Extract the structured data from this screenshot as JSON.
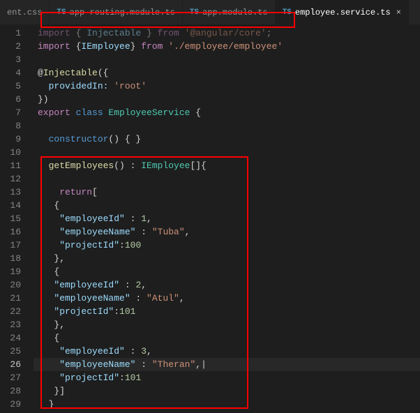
{
  "tabs": [
    {
      "icon": "",
      "label": "ent.css"
    },
    {
      "icon": "TS",
      "label": "app-routing.module.ts"
    },
    {
      "icon": "TS",
      "label": "app.module.ts"
    },
    {
      "icon": "TS",
      "label": "employee.service.ts",
      "active": true
    }
  ],
  "closeX": "×",
  "code": {
    "l1": {
      "a": "import",
      "b": " { ",
      "c": "Injectable",
      "d": " } ",
      "e": "from",
      "f": " '@angular/core'",
      "g": ";"
    },
    "l2": {
      "a": "import",
      "b": " {",
      "c": "IEmployee",
      "d": "} ",
      "e": "from",
      "f": " '",
      "g": "./employee/employee",
      "h": "'"
    },
    "l4": {
      "a": "@",
      "b": "Injectable",
      "c": "({"
    },
    "l5": {
      "a": "  providedIn:",
      "b": " 'root'"
    },
    "l6": {
      "a": "})"
    },
    "l7": {
      "a": "export",
      "b": " class",
      "c": " EmployeeService",
      "d": " {"
    },
    "l9": {
      "a": "  constructor",
      "b": "() { }"
    },
    "l11": {
      "a": "  getEmployees",
      "b": "() : ",
      "c": "IEmployee",
      "d": "[]{"
    },
    "l13": {
      "a": "    return",
      "b": "["
    },
    "l14": {
      "a": "   {"
    },
    "l15": {
      "a": "    \"employeeId\"",
      "b": " : ",
      "c": "1",
      "d": ","
    },
    "l16": {
      "a": "    \"employeeName\"",
      "b": " : ",
      "c": "\"Tuba\"",
      "d": ","
    },
    "l17": {
      "a": "    \"projectId\"",
      "b": ":",
      "c": "100"
    },
    "l18": {
      "a": "   },"
    },
    "l19": {
      "a": "   {"
    },
    "l20": {
      "a": "   \"employeeId\"",
      "b": " : ",
      "c": "2",
      "d": ","
    },
    "l21": {
      "a": "   \"employeeName\"",
      "b": " : ",
      "c": "\"Atul\"",
      "d": ","
    },
    "l22": {
      "a": "   \"projectId\"",
      "b": ":",
      "c": "101"
    },
    "l23": {
      "a": "   },"
    },
    "l24": {
      "a": "   {"
    },
    "l25": {
      "a": "    \"employeeId\"",
      "b": " : ",
      "c": "3",
      "d": ","
    },
    "l26": {
      "a": "    \"employeeName\"",
      "b": " : ",
      "c": "\"Theran\"",
      "d": ",|"
    },
    "l27": {
      "a": "    \"projectId\"",
      "b": ":",
      "c": "101"
    },
    "l28": {
      "a": "   }]"
    },
    "l29": {
      "a": "  }"
    }
  }
}
